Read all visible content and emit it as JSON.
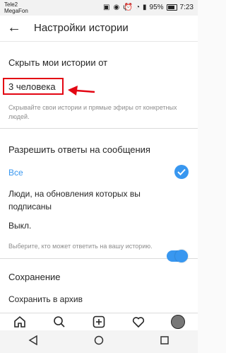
{
  "status_bar": {
    "carrier_1": "Tele2",
    "carrier_2": "MegaFon",
    "battery": "95%",
    "time": "7:23"
  },
  "header": {
    "title": "Настройки истории"
  },
  "hide_section": {
    "title": "Скрыть мои истории от",
    "value": "3 человека",
    "hint": "Скрывайте свои истории и прямые эфиры от конкретных людей."
  },
  "replies_section": {
    "title": "Разрешить ответы на сообщения",
    "options": [
      {
        "label": "Все",
        "selected": true
      },
      {
        "label": "Люди, на обновления которых вы подписаны",
        "selected": false
      },
      {
        "label": "Выкл.",
        "selected": false
      }
    ],
    "hint": "Выберите, кто может ответить на вашу историю."
  },
  "save_section": {
    "title": "Сохранение",
    "archive_label": "Сохранить в архив",
    "archive_on": true
  },
  "colors": {
    "accent": "#3897f0",
    "highlight": "#e30613"
  },
  "icons": {
    "tabbar": [
      "home-icon",
      "search-icon",
      "add-icon",
      "heart-icon",
      "profile-avatar"
    ],
    "navbar": [
      "back-triangle-icon",
      "home-circle-icon",
      "recents-square-icon"
    ]
  }
}
